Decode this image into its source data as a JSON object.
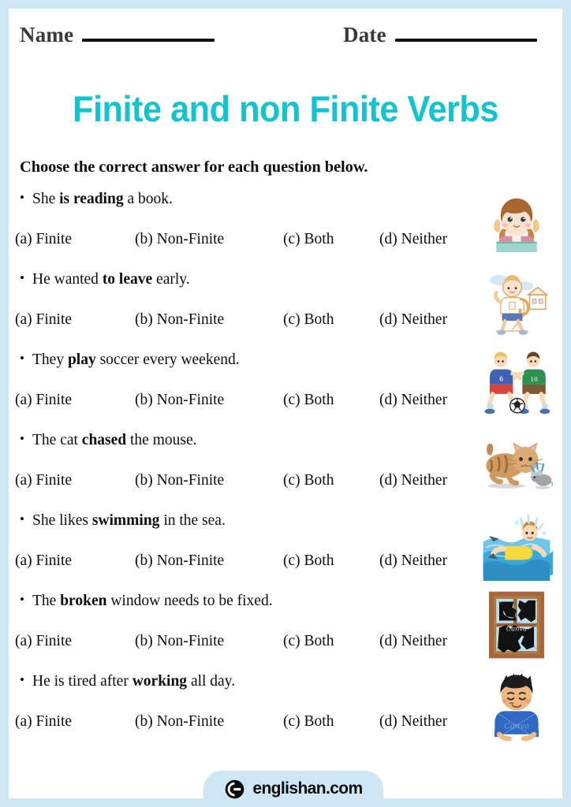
{
  "header": {
    "name_label": "Name",
    "date_label": "Date"
  },
  "title": "Finite and non Finite Verbs",
  "instruction": "Choose the correct answer for each question below.",
  "options": [
    "(a) Finite",
    "(b) Non-Finite",
    "(c) Both",
    "(d) Neither"
  ],
  "bullet": "•",
  "questions": [
    {
      "pre": "She ",
      "bold": "is reading",
      "post": " a book.",
      "illustration": "girl-reading-book-icon"
    },
    {
      "pre": "He wanted ",
      "bold": "to leave",
      "post": " early.",
      "illustration": "boy-walking-to-school-icon"
    },
    {
      "pre": "They ",
      "bold": "play",
      "post": " soccer every weekend.",
      "illustration": "boys-playing-soccer-icon"
    },
    {
      "pre": "The cat ",
      "bold": "chased",
      "post": " the mouse.",
      "illustration": "cat-chasing-mouse-icon"
    },
    {
      "pre": "She likes ",
      "bold": "swimming",
      "post": " in the sea.",
      "illustration": "girl-swimming-icon"
    },
    {
      "pre": "The ",
      "bold": "broken",
      "post": " window needs to be fixed.",
      "illustration": "broken-window-icon"
    },
    {
      "pre": "He is tired after ",
      "bold": "working",
      "post": " all day.",
      "illustration": "tired-boy-icon"
    }
  ],
  "footer": {
    "brand": "englishan.com",
    "logo": "englishan-circle-logo-icon"
  },
  "colors": {
    "frame": "#cfe7f5",
    "title": "#13c4d0",
    "page": "#ffffff",
    "text": "#0d0d0d"
  }
}
